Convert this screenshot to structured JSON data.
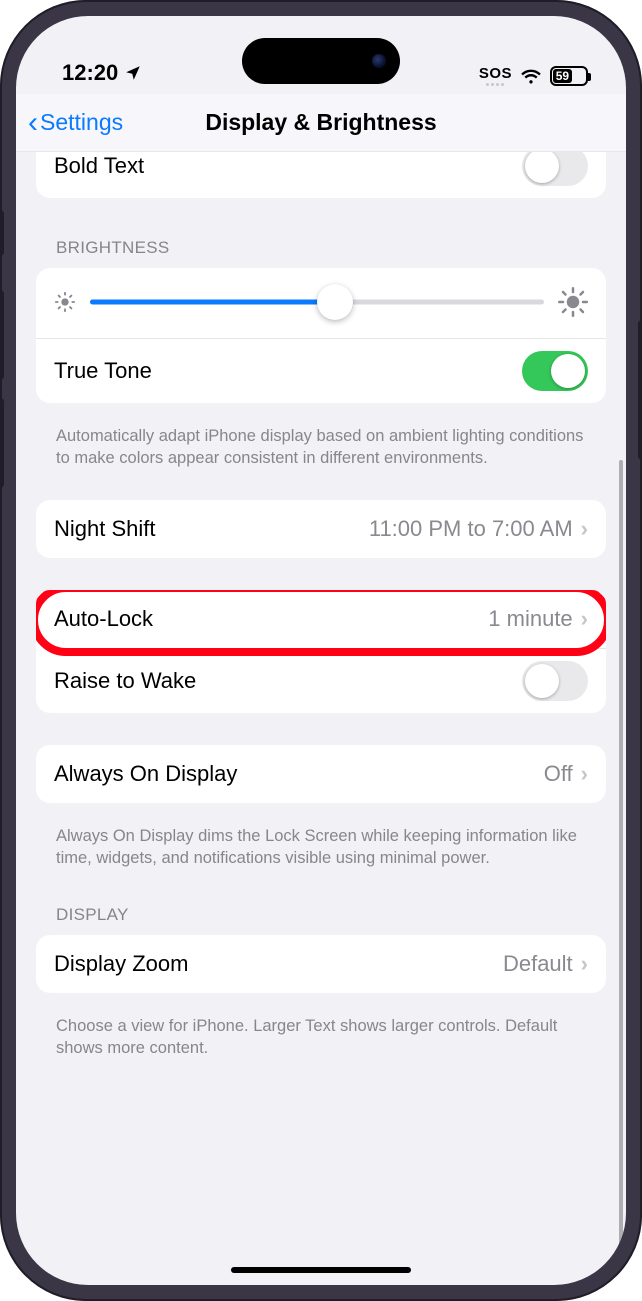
{
  "status": {
    "time": "12:20",
    "sos": "SOS",
    "battery_pct": "59",
    "battery_fill_width": "59%"
  },
  "nav": {
    "back_label": "Settings",
    "title": "Display & Brightness"
  },
  "rows": {
    "bold_text": "Bold Text",
    "brightness_header": "Brightness",
    "true_tone": "True Tone",
    "true_tone_footer": "Automatically adapt iPhone display based on ambient lighting conditions to make colors appear consistent in different environments.",
    "night_shift": "Night Shift",
    "night_shift_value": "11:00 PM to 7:00 AM",
    "auto_lock": "Auto-Lock",
    "auto_lock_value": "1 minute",
    "raise_to_wake": "Raise to Wake",
    "always_on": "Always On Display",
    "always_on_value": "Off",
    "always_on_footer": "Always On Display dims the Lock Screen while keeping information like time, widgets, and notifications visible using minimal power.",
    "display_header": "Display",
    "display_zoom": "Display Zoom",
    "display_zoom_value": "Default",
    "display_zoom_footer": "Choose a view for iPhone. Larger Text shows larger controls. Default shows more content."
  },
  "slider": {
    "value_pct": 54
  },
  "highlight": {
    "target": "auto-lock-row"
  }
}
